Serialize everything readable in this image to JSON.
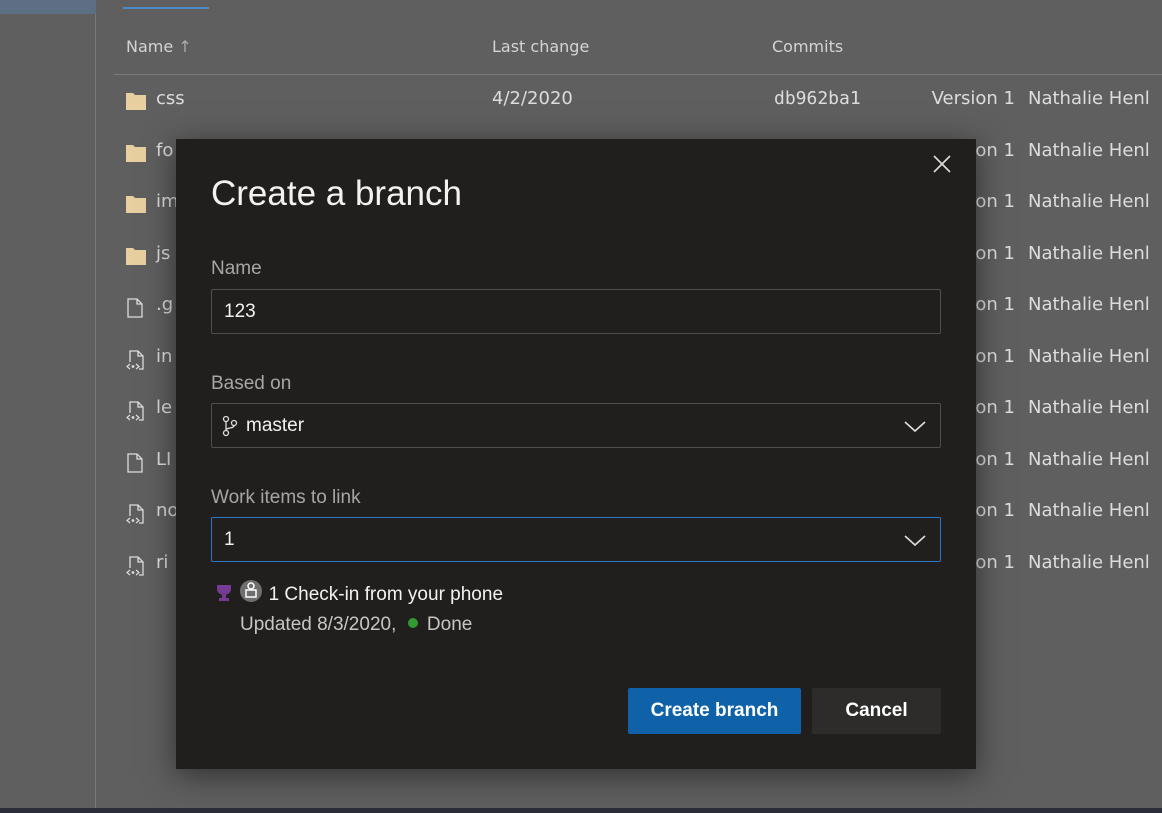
{
  "table": {
    "headers": {
      "name": "Name",
      "sort_indicator": "↑",
      "last_change": "Last change",
      "commits": "Commits"
    },
    "rows": [
      {
        "type": "folder",
        "name": "css",
        "last_change": "4/2/2020",
        "commit": "db962ba1",
        "message": "Version 1",
        "author": "Nathalie Henl"
      },
      {
        "type": "folder",
        "name": "fo",
        "message": "on 1",
        "author": "Nathalie Henl"
      },
      {
        "type": "folder",
        "name": "im",
        "message": "on 1",
        "author": "Nathalie Henl"
      },
      {
        "type": "folder",
        "name": "js",
        "message": "on 1",
        "author": "Nathalie Henl"
      },
      {
        "type": "file",
        "name": ".g",
        "message": "on 1",
        "author": "Nathalie Henl"
      },
      {
        "type": "code-file",
        "name": "in",
        "message": "on 1",
        "author": "Nathalie Henl"
      },
      {
        "type": "code-file",
        "name": "le",
        "message": "on 1",
        "author": "Nathalie Henl"
      },
      {
        "type": "file",
        "name": "LI",
        "message": "on 1",
        "author": "Nathalie Henl"
      },
      {
        "type": "code-file",
        "name": "no",
        "message": "on 1",
        "author": "Nathalie Henl"
      },
      {
        "type": "code-file",
        "name": "ri",
        "message": "on 1",
        "author": "Nathalie Henl"
      }
    ]
  },
  "dialog": {
    "title": "Create a branch",
    "name_label": "Name",
    "name_value": "123",
    "based_on_label": "Based on",
    "based_on_value": "master",
    "work_items_label": "Work items to link",
    "work_items_value": "1",
    "work_item": {
      "title": "1 Check-in from your phone",
      "updated": "Updated 8/3/2020,",
      "state": "Done",
      "state_color": "#339933",
      "type_color": "#773b93"
    },
    "create_label": "Create branch",
    "cancel_label": "Cancel"
  }
}
